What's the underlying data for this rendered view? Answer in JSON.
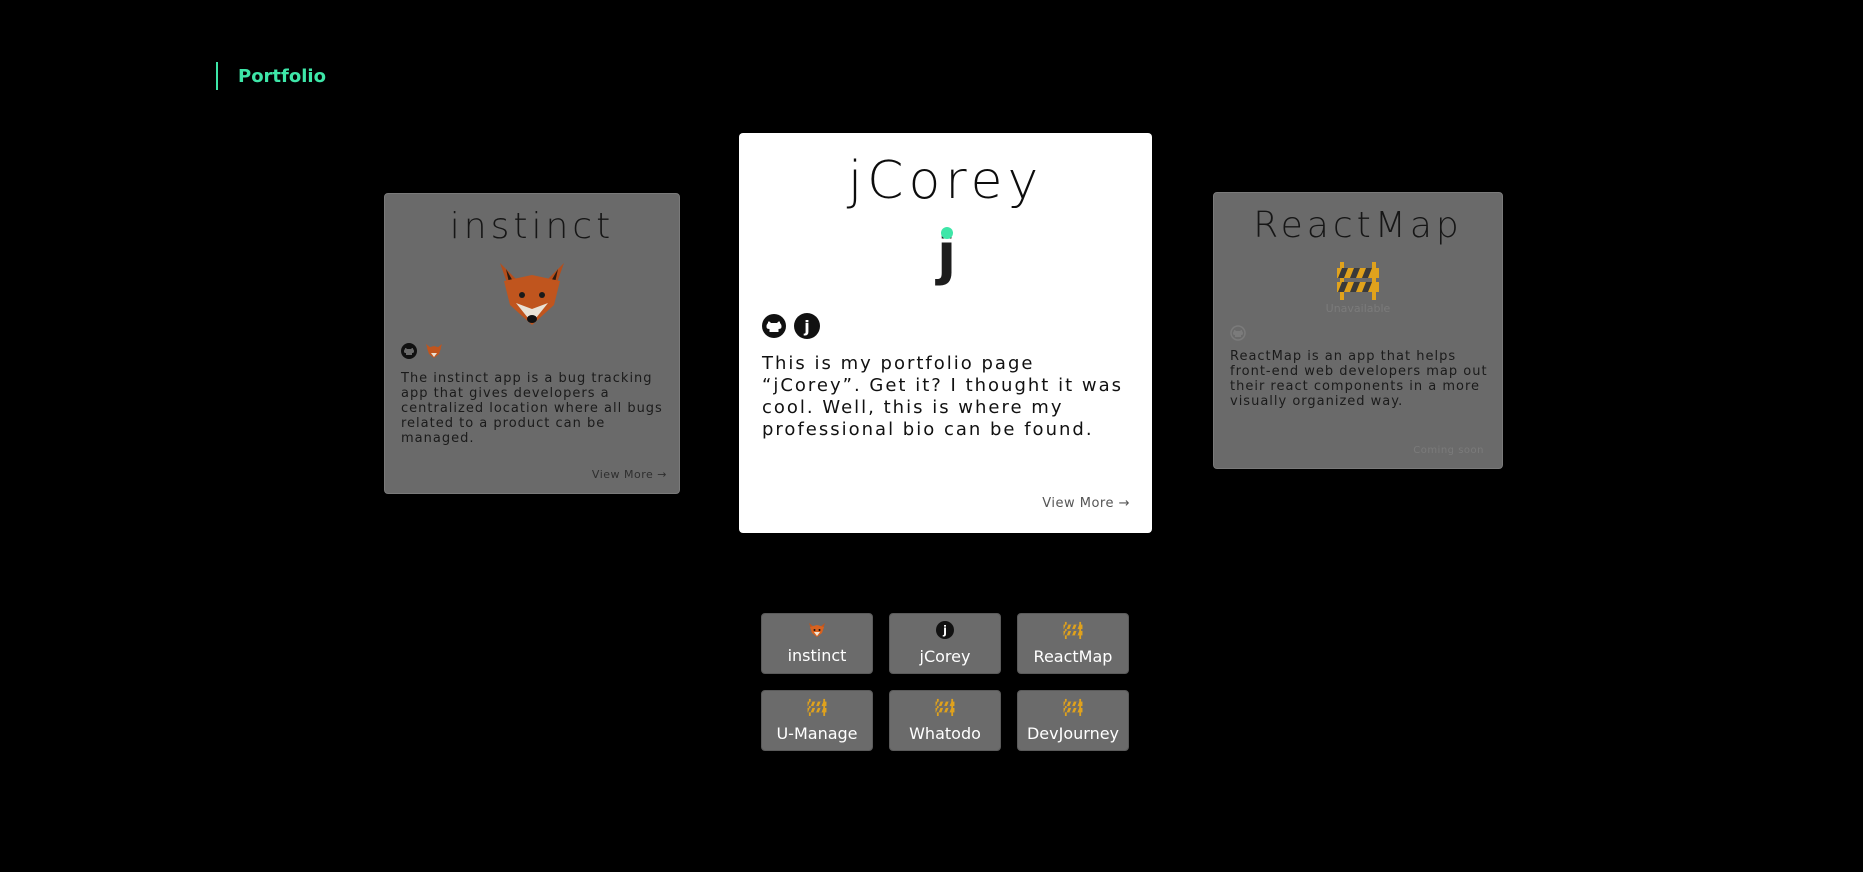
{
  "header": {
    "title": "Portfolio"
  },
  "cards": {
    "instinct": {
      "title": "instinct",
      "description": "The instinct app is a bug tracking app that gives developers a centralized location where all bugs related to a product can be managed.",
      "link": "View More →"
    },
    "jcorey": {
      "title": "jCorey",
      "logo_letter": "j",
      "description": "This is my portfolio page “jCorey”. Get it? I thought it was cool. Well, this is where my professional bio can be found.",
      "link": "View More →"
    },
    "reactmap": {
      "title": "ReactMap",
      "status": "Unavailable",
      "description": "ReactMap is an app that helps front-end web developers map out their react components in a more visually organized way.",
      "link": "Coming soon"
    }
  },
  "chips": [
    {
      "label": "instinct",
      "icon": "fox-icon"
    },
    {
      "label": "jCorey",
      "icon": "j-icon"
    },
    {
      "label": "ReactMap",
      "icon": "barrier-icon"
    },
    {
      "label": "U-Manage",
      "icon": "barrier-icon"
    },
    {
      "label": "Whatodo",
      "icon": "barrier-icon"
    },
    {
      "label": "DevJourney",
      "icon": "barrier-icon"
    }
  ],
  "colors": {
    "accent": "#3ee6a8",
    "fox": "#c0551e",
    "barrier": "#e0a21c"
  }
}
